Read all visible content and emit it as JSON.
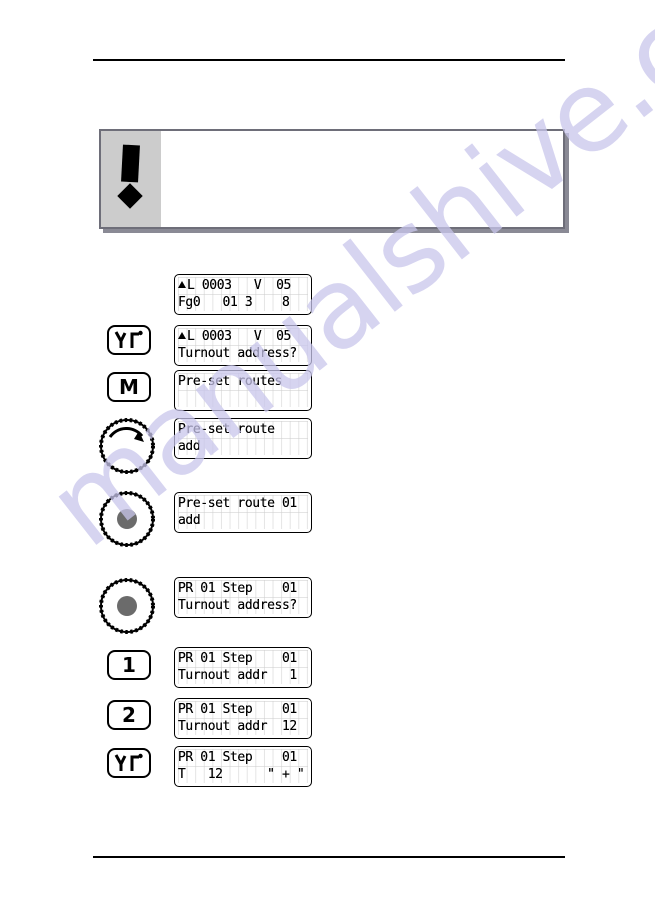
{
  "page": {
    "background_color": "#ffffff",
    "rule_color": "#000000",
    "watermark_text": "manualshive.com",
    "watermark_color": "#c9c6ec"
  },
  "note_box": {
    "icon": "exclamation-mark",
    "icon_panel_color": "#cccccc",
    "border_color": "#6e6e79",
    "shadow_color": "#8a8a95",
    "body_text": ""
  },
  "sequence": {
    "steps": [
      {
        "key": null,
        "key_type": "none",
        "display": {
          "line1_prefix_marker": "triangle-up",
          "line1": "L 0003   V  05",
          "line2": "Fg0   01 3    8"
        }
      },
      {
        "key": "turnout-key",
        "key_type": "turnout",
        "key_label": "",
        "display": {
          "line1_prefix_marker": "triangle-up",
          "line1": "L 0003   V  05",
          "line2": "Turnout address?"
        }
      },
      {
        "key": "menu-key",
        "key_type": "letter",
        "key_label": "M",
        "display": {
          "line1": "Pre-set routes",
          "line2": ""
        }
      },
      {
        "key": "rotary-turn",
        "key_type": "knob-turn",
        "key_label": "",
        "display": {
          "line1": "Pre-set route",
          "line2": "add"
        }
      },
      {
        "key": "rotary-press",
        "key_type": "knob-press",
        "key_label": "",
        "display": {
          "line1": "Pre-set route 01",
          "line2": "add"
        }
      },
      {
        "key": "rotary-press",
        "key_type": "knob-press",
        "key_label": "",
        "display": {
          "line1": "PR 01 Step    01",
          "line2": "Turnout address?"
        }
      },
      {
        "key": "digit-1-key",
        "key_type": "digit",
        "key_label": "1",
        "display": {
          "line1": "PR 01 Step    01",
          "line2": "Turnout addr   1"
        }
      },
      {
        "key": "digit-2-key",
        "key_type": "digit",
        "key_label": "2",
        "display": {
          "line1": "PR 01 Step    01",
          "line2": "Turnout addr  12"
        }
      },
      {
        "key": "turnout-key",
        "key_type": "turnout",
        "key_label": "",
        "display": {
          "line1": "PR 01 Step    01",
          "line2": "T   12      \" + \""
        }
      }
    ]
  }
}
